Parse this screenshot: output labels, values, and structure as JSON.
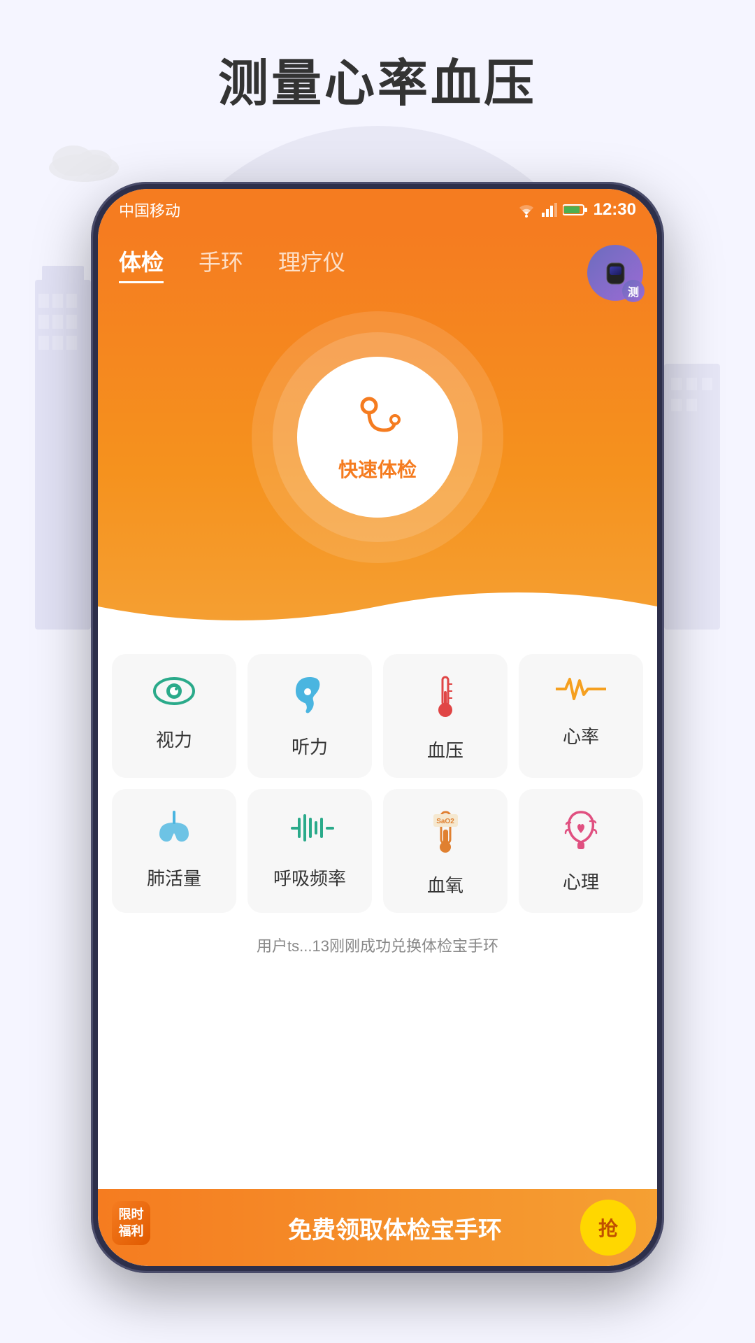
{
  "page": {
    "title": "测量心率血压",
    "background_color": "#f5f5ff"
  },
  "status_bar": {
    "carrier": "中国移动",
    "time": "12:30",
    "wifi_icon": "wifi",
    "signal_icon": "signal",
    "battery_icon": "battery"
  },
  "tabs": [
    {
      "id": "physical",
      "label": "体检",
      "active": true
    },
    {
      "id": "bracelet",
      "label": "手环",
      "active": false
    },
    {
      "id": "therapy",
      "label": "理疗仪",
      "active": false
    }
  ],
  "center_button": {
    "label": "快速体检",
    "icon": "stethoscope"
  },
  "wristband_badge": {
    "label": "测"
  },
  "grid_row1": [
    {
      "id": "vision",
      "label": "视力",
      "icon": "eye",
      "color": "#2aaa8a"
    },
    {
      "id": "hearing",
      "label": "听力",
      "icon": "ear",
      "color": "#4ab5e0"
    },
    {
      "id": "blood_pressure",
      "label": "血压",
      "icon": "thermometer",
      "color": "#e04545"
    },
    {
      "id": "heart_rate",
      "label": "心率",
      "icon": "heartrate",
      "color": "#f5a020"
    }
  ],
  "grid_row2": [
    {
      "id": "lung",
      "label": "肺活量",
      "icon": "lungs",
      "color": "#4ab5e0"
    },
    {
      "id": "breath",
      "label": "呼吸频率",
      "icon": "breath",
      "color": "#2aaa8a"
    },
    {
      "id": "oxygen",
      "label": "血氧",
      "icon": "oxygen",
      "color": "#e08030"
    },
    {
      "id": "mental",
      "label": "心理",
      "icon": "brain",
      "color": "#e05080"
    }
  ],
  "notification": {
    "text": "用户ts...13刚刚成功兑换体检宝手环"
  },
  "promo": {
    "badge_line1": "限时",
    "badge_line2": "福利",
    "text": "免费领取体检宝手环",
    "btn_label": "抢"
  },
  "cloud": {
    "visible": true
  }
}
